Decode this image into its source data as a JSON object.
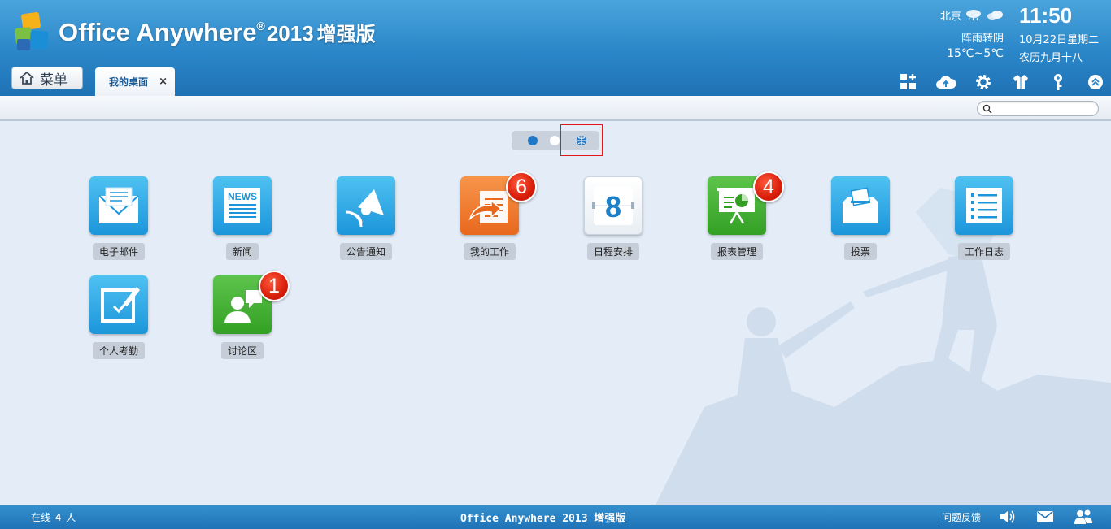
{
  "header": {
    "brand": "Office Anywhere",
    "reg_mark": "®",
    "version": "2013",
    "edition": "增强版"
  },
  "weather": {
    "city": "北京",
    "condition": "阵雨转阴",
    "temperature": "15℃~5℃",
    "icons": [
      "shower-icon",
      "cloud-icon"
    ]
  },
  "clock": {
    "time": "11:50",
    "date": "10月22日星期二",
    "lunar": "农历九月十八"
  },
  "nav": {
    "menu_label": "菜单",
    "tab_label": "我的桌面",
    "tab_close": "×"
  },
  "toolbar": {
    "icons": [
      "add-widget-icon",
      "cloud-upload-icon",
      "settings-gear-icon",
      "theme-shirt-icon",
      "key-icon",
      "collapse-up-icon"
    ]
  },
  "search": {
    "placeholder": ""
  },
  "apps": [
    {
      "label": "电子邮件",
      "icon": "email-icon",
      "color": "#1c95da"
    },
    {
      "label": "新闻",
      "icon": "news-icon",
      "color": "#1c95da"
    },
    {
      "label": "公告通知",
      "icon": "bell-icon",
      "color": "#1c95da"
    },
    {
      "label": "我的工作",
      "icon": "work-forward-icon",
      "color": "#e8681e",
      "badge": "6"
    },
    {
      "label": "日程安排",
      "icon": "calendar-icon",
      "color": "#ffffff",
      "calendar_day": "8"
    },
    {
      "label": "报表管理",
      "icon": "report-presentation-icon",
      "color": "#33a024",
      "badge": "4"
    },
    {
      "label": "投票",
      "icon": "ballot-box-icon",
      "color": "#1c95da"
    },
    {
      "label": "工作日志",
      "icon": "list-log-icon",
      "color": "#1c95da"
    },
    {
      "label": "个人考勤",
      "icon": "attendance-edit-icon",
      "color": "#1c95da"
    },
    {
      "label": "讨论区",
      "icon": "discussion-icon",
      "color": "#33a024",
      "badge": "1"
    }
  ],
  "status": {
    "online_prefix": "在线",
    "online_count": "4",
    "online_suffix": "人",
    "footer_title": "Office Anywhere 2013 增强版",
    "feedback": "问题反馈",
    "icons": [
      "speaker-icon",
      "mail-icon",
      "users-icon"
    ]
  }
}
